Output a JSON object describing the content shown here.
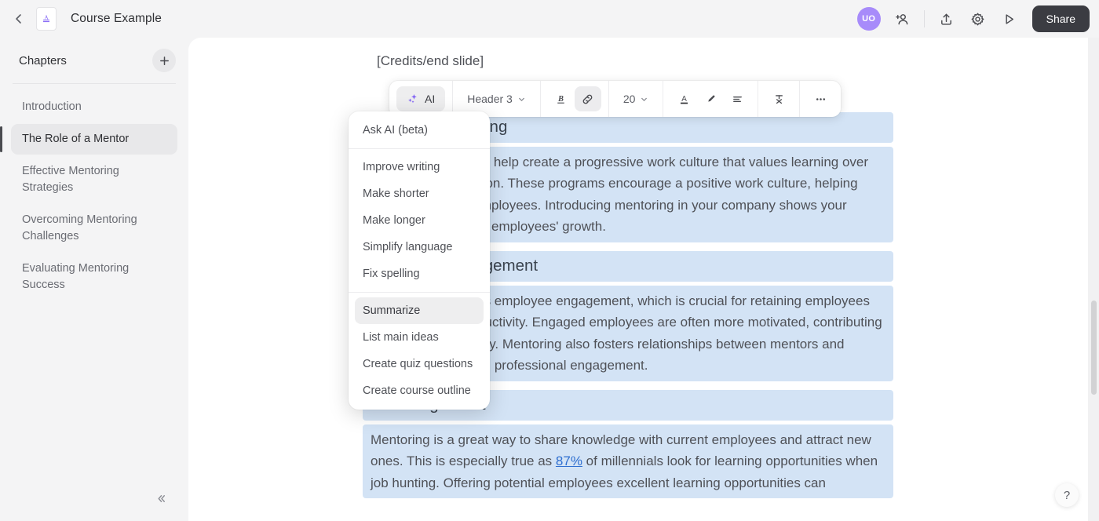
{
  "header": {
    "back_icon": "chevron-left-icon",
    "doc_icon": "document-icon",
    "title": "Course Example",
    "avatar_initials": "UO",
    "add_user_icon": "add-person-icon",
    "upload_icon": "share-upload-icon",
    "settings_icon": "gear-icon",
    "preview_icon": "play-icon",
    "share_label": "Share"
  },
  "sidebar": {
    "title": "Chapters",
    "add_icon": "plus-icon",
    "collapse_icon": "double-chevron-left-icon",
    "items": [
      {
        "label": "Introduction",
        "active": false
      },
      {
        "label": "The Role of a Mentor",
        "active": true
      },
      {
        "label": "Effective Mentoring Strategies",
        "active": false
      },
      {
        "label": "Overcoming Mentoring Challenges",
        "active": false
      },
      {
        "label": "Evaluating Mentoring Success",
        "active": false
      }
    ]
  },
  "editor_toolbar": {
    "ai_label": "AI",
    "ai_icon": "sparkles-icon",
    "block_style": "Header 3",
    "bold_icon": "bold-icon",
    "link_icon": "link-icon",
    "font_size": "20",
    "text_color_icon": "text-color-icon",
    "highlighter_icon": "highlighter-pen-icon",
    "align_icon": "align-left-icon",
    "clear_format_icon": "clear-formatting-icon",
    "more_icon": "more-options-icon"
  },
  "ai_menu": {
    "primary": "Ask AI (beta)",
    "items": [
      {
        "label": "Improve writing",
        "highlighted": false
      },
      {
        "label": "Make shorter",
        "highlighted": false
      },
      {
        "label": "Make longer",
        "highlighted": false
      },
      {
        "label": "Simplify language",
        "highlighted": false
      },
      {
        "label": "Fix spelling",
        "highlighted": false
      }
    ],
    "items2": [
      {
        "label": "Summarize",
        "highlighted": true
      },
      {
        "label": "List main ideas",
        "highlighted": false
      },
      {
        "label": "Create quiz questions",
        "highlighted": false
      },
      {
        "label": "Create course outline",
        "highlighted": false
      }
    ]
  },
  "document": {
    "credits_line": "[Credits/end slide]",
    "blocks": [
      {
        "type": "heading",
        "text": "Culture of Learning",
        "selected": true
      },
      {
        "type": "paragraph",
        "text": "Mentoring programs help create a progressive work culture that values learning over unhealthy competition. These programs encourage a positive work culture, helping retain productive employees. Introducing mentoring in your company shows your commitment to your employees' growth.",
        "selected": true
      },
      {
        "type": "heading",
        "text": "Employee Engagement",
        "selected": true
      },
      {
        "type": "paragraph",
        "text": "Mentoring increases employee engagement, which is crucial for retaining employees and improving productivity. Engaged employees are often more motivated, contributing more to the company. Mentoring also fosters relationships between mentors and mentees, enhancing professional engagement.",
        "selected": true
      },
      {
        "type": "heading",
        "text": "Attracting Talent",
        "selected": true
      },
      {
        "type": "paragraph_link",
        "before": "Mentoring is a great way to share knowledge with current employees and attract new ones. This is especially true as ",
        "link": "87%",
        "after": " of millennials look for learning opportunities when job hunting. Offering potential employees excellent learning opportunities can",
        "selected": true
      }
    ]
  },
  "help": {
    "label": "?"
  },
  "colors": {
    "accent_purple": "#7c5cf5",
    "avatar_bg": "#a78bfa",
    "selection_blue": "#d3e3f5",
    "link_blue": "#2f6fd0",
    "share_dark": "#3b3c42"
  }
}
